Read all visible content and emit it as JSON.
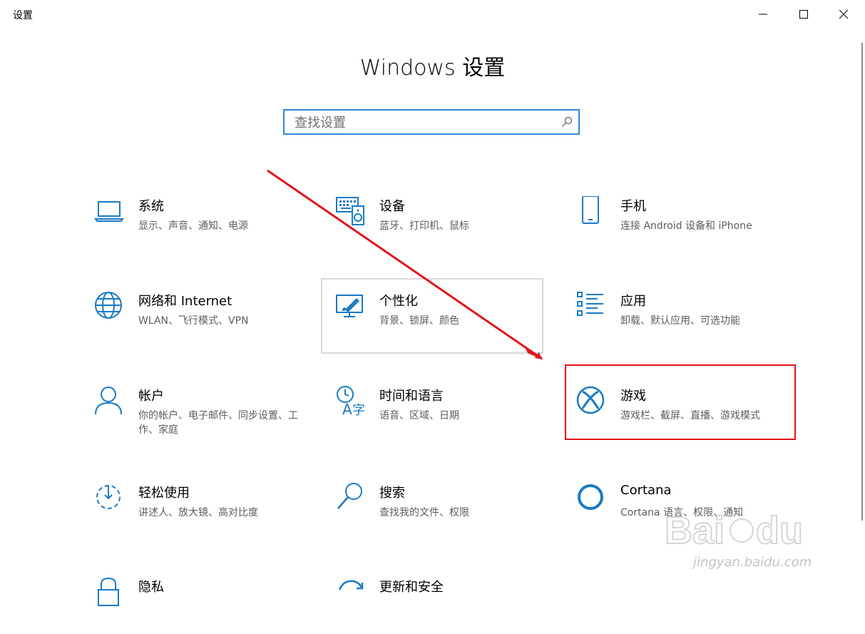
{
  "window": {
    "title": "设置"
  },
  "header": {
    "title": "Windows 设置"
  },
  "search": {
    "placeholder": "查找设置"
  },
  "tiles": [
    {
      "title": "系统",
      "desc": "显示、声音、通知、电源"
    },
    {
      "title": "设备",
      "desc": "蓝牙、打印机、鼠标"
    },
    {
      "title": "手机",
      "desc": "连接 Android 设备和 iPhone"
    },
    {
      "title": "网络和 Internet",
      "desc": "WLAN、飞行模式、VPN"
    },
    {
      "title": "个性化",
      "desc": "背景、锁屏、颜色"
    },
    {
      "title": "应用",
      "desc": "卸载、默认应用、可选功能"
    },
    {
      "title": "帐户",
      "desc": "你的帐户、电子邮件、同步设置、工作、家庭"
    },
    {
      "title": "时间和语言",
      "desc": "语音、区域、日期"
    },
    {
      "title": "游戏",
      "desc": "游戏栏、截屏、直播、游戏模式"
    },
    {
      "title": "轻松使用",
      "desc": "讲述人、放大镜、高对比度"
    },
    {
      "title": "搜索",
      "desc": "查找我的文件、权限"
    },
    {
      "title": "Cortana",
      "desc": "Cortana 语言、权限、通知"
    },
    {
      "title": "隐私",
      "desc": ""
    },
    {
      "title": "更新和安全",
      "desc": ""
    }
  ],
  "watermark": {
    "text": "jingyan.baidu.com"
  },
  "colors": {
    "accent": "#0f6cbd",
    "icon": "#1a7ac4",
    "highlight": "#e3151b"
  }
}
